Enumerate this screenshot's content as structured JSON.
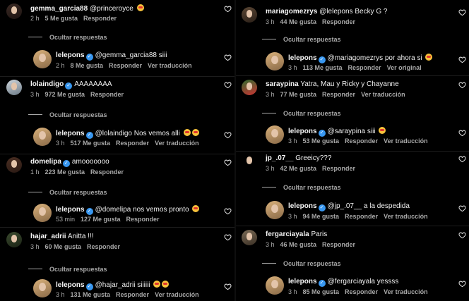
{
  "labels": {
    "likes_suffix": "Me gusta",
    "reply": "Responder",
    "see_translation": "Ver traducción",
    "see_original": "Ver original",
    "hide_replies": "Ocultar respuestas"
  },
  "left": {
    "comments": [
      {
        "user": "gemma_garcia88",
        "verified": false,
        "text": "@princeroyce",
        "emoji": true,
        "time": "2 h",
        "likes": "5 Me gusta",
        "reply": "Responder",
        "extra": ""
      },
      {
        "user": "lelepons",
        "verified": true,
        "text": "@gemma_garcia88 siii",
        "emoji": false,
        "time": "2 h",
        "likes": "8 Me gusta",
        "reply": "Responder",
        "extra": "Ver traducción"
      },
      {
        "user": "lolaindigo",
        "verified": true,
        "text": "AAAAAAAA",
        "emoji": false,
        "time": "3 h",
        "likes": "972 Me gusta",
        "reply": "Responder",
        "extra": ""
      },
      {
        "user": "lelepons",
        "verified": true,
        "text": "@lolaindigo Nos vemos alli",
        "emoji": true,
        "emoji2": true,
        "time": "3 h",
        "likes": "517 Me gusta",
        "reply": "Responder",
        "extra": "Ver traducción"
      },
      {
        "user": "domelipa",
        "verified": true,
        "text": "amooooooo",
        "emoji": false,
        "time": "1 h",
        "likes": "223 Me gusta",
        "reply": "Responder",
        "extra": ""
      },
      {
        "user": "lelepons",
        "verified": true,
        "text": "@domelipa nos vemos pronto",
        "emoji": true,
        "time": "53 min",
        "likes": "127 Me gusta",
        "reply": "Responder",
        "extra": ""
      },
      {
        "user": "hajar_adrii",
        "verified": false,
        "text": "Anitta !!!",
        "emoji": false,
        "time": "3 h",
        "likes": "60 Me gusta",
        "reply": "Responder",
        "extra": ""
      },
      {
        "user": "lelepons",
        "verified": true,
        "text": "@hajar_adrii siiiiii",
        "emoji": true,
        "emoji2": true,
        "time": "3 h",
        "likes": "131 Me gusta",
        "reply": "Responder",
        "extra": "Ver traducción"
      }
    ]
  },
  "right": {
    "comments": [
      {
        "user": "mariagomezrys",
        "verified": false,
        "text": "@lelepons Becky G ?",
        "emoji": false,
        "time": "3 h",
        "likes": "44 Me gusta",
        "reply": "Responder",
        "extra": ""
      },
      {
        "user": "lelepons",
        "verified": true,
        "text": "@mariagomezrys por ahora si",
        "emoji": true,
        "time": "3 h",
        "likes": "113 Me gusta",
        "reply": "Responder",
        "extra": "Ver original"
      },
      {
        "user": "saraypina",
        "verified": false,
        "text": "Yatra, Mau y Ricky y Chayanne",
        "emoji": false,
        "time": "3 h",
        "likes": "77 Me gusta",
        "reply": "Responder",
        "extra": "Ver traducción"
      },
      {
        "user": "lelepons",
        "verified": true,
        "text": "@saraypina siii",
        "emoji": true,
        "time": "3 h",
        "likes": "53 Me gusta",
        "reply": "Responder",
        "extra": "Ver traducción"
      },
      {
        "user": "jp_.07__",
        "verified": false,
        "text": "Greeicy???",
        "emoji": false,
        "time": "3 h",
        "likes": "42 Me gusta",
        "reply": "Responder",
        "extra": ""
      },
      {
        "user": "lelepons",
        "verified": true,
        "text": "@jp_.07__ a la despedida",
        "emoji": false,
        "time": "3 h",
        "likes": "94 Me gusta",
        "reply": "Responder",
        "extra": "Ver traducción"
      },
      {
        "user": "fergarciayala",
        "verified": false,
        "text": "Paris",
        "emoji": false,
        "time": "3 h",
        "likes": "46 Me gusta",
        "reply": "Responder",
        "extra": ""
      },
      {
        "user": "lelepons",
        "verified": true,
        "text": "@fergarciayala yessss",
        "emoji": false,
        "time": "3 h",
        "likes": "85 Me gusta",
        "reply": "Responder",
        "extra": "Ver traducción"
      }
    ]
  },
  "colors": {
    "background": "#000000",
    "text": "#f5f5f5",
    "muted": "#a8a8a8",
    "verified": "#3897f0"
  },
  "icons": {
    "like": "heart-icon",
    "verified": "verified-badge-icon",
    "reply_toggle": "dash-icon"
  }
}
